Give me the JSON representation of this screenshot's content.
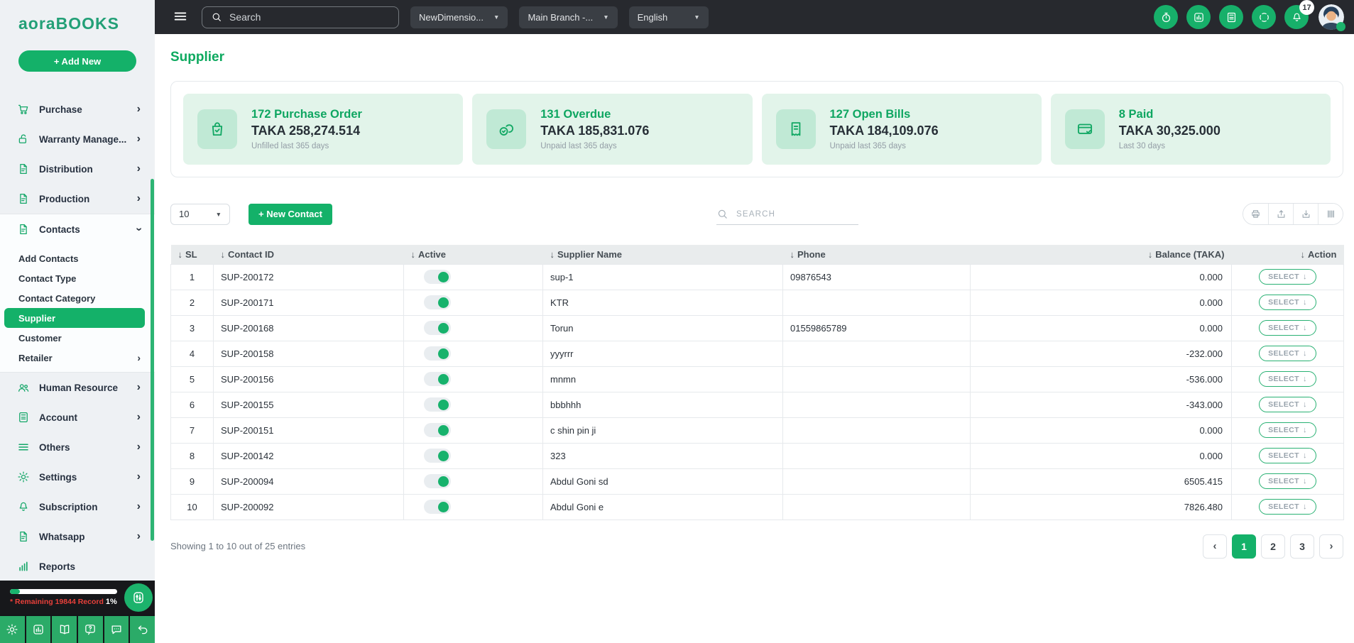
{
  "brand": {
    "logo_text": "aoraBOOKS",
    "add_new_label": "+ Add New"
  },
  "topbar": {
    "search_placeholder": "Search",
    "dropdowns": [
      {
        "label": "NewDimensio..."
      },
      {
        "label": "Main Branch -..."
      },
      {
        "label": "English"
      }
    ],
    "icon_names": [
      "timer-icon",
      "chart-box-icon",
      "calculator-icon",
      "scan-icon",
      "bell-icon"
    ],
    "notification_count": "17"
  },
  "sidebar": {
    "items": [
      {
        "label": "Purchase",
        "icon": "cart-icon",
        "chevron": "›"
      },
      {
        "label": "Warranty Manage...",
        "icon": "lock-open-icon",
        "chevron": "›"
      },
      {
        "label": "Distribution",
        "icon": "document-icon",
        "chevron": "›"
      },
      {
        "label": "Production",
        "icon": "document-icon",
        "chevron": "›"
      }
    ],
    "contacts": {
      "label": "Contacts",
      "icon": "document-icon",
      "chevron": "›",
      "expanded": true
    },
    "contacts_submenu": [
      {
        "label": "Add Contacts",
        "chevron": ""
      },
      {
        "label": "Contact Type",
        "chevron": ""
      },
      {
        "label": "Contact Category",
        "chevron": ""
      },
      {
        "label": "Supplier",
        "chevron": "",
        "active": true
      },
      {
        "label": "Customer",
        "chevron": ""
      },
      {
        "label": "Retailer",
        "chevron": "›"
      }
    ],
    "items_lower": [
      {
        "label": "Human Resource",
        "icon": "users-icon",
        "chevron": "›"
      },
      {
        "label": "Account",
        "icon": "calculator-icon",
        "chevron": "›"
      },
      {
        "label": "Others",
        "icon": "menu-lines-icon",
        "chevron": "›"
      },
      {
        "label": "Settings",
        "icon": "gear-icon",
        "chevron": "›"
      },
      {
        "label": "Subscription",
        "icon": "bell-icon",
        "chevron": "›"
      },
      {
        "label": "Whatsapp",
        "icon": "document-icon",
        "chevron": "›"
      },
      {
        "label": "Reports",
        "icon": "bar-chart-icon",
        "chevron": ""
      }
    ],
    "footer": {
      "remaining_label": "* Remaining 19844 Record",
      "remaining_percent": "1%",
      "progress_value": 1,
      "quick_icons": [
        "gear-icon",
        "chart-box-icon",
        "book-icon",
        "help-icon",
        "chat-icon",
        "undo-icon"
      ]
    }
  },
  "page": {
    "title": "Supplier"
  },
  "summary_cards": [
    {
      "title": "172 Purchase Order",
      "amount": "TAKA 258,274.514",
      "subtitle": "Unfilled last 365 days",
      "icon": "bag-check-icon"
    },
    {
      "title": "131 Overdue",
      "amount": "TAKA 185,831.076",
      "subtitle": "Unpaid last 365 days",
      "icon": "coins-icon"
    },
    {
      "title": "127 Open Bills",
      "amount": "TAKA 184,109.076",
      "subtitle": "Unpaid last 365 days",
      "icon": "receipt-icon"
    },
    {
      "title": "8 Paid",
      "amount": "TAKA 30,325.000",
      "subtitle": "Last 30 days",
      "icon": "card-check-icon"
    }
  ],
  "toolbar": {
    "page_size": "10",
    "new_contact_label": "+ New Contact",
    "search_placeholder": "SEARCH",
    "action_icons": [
      "print-icon",
      "export-icon",
      "download-icon",
      "columns-icon"
    ]
  },
  "table": {
    "sort_arrow": "↓",
    "select_label": "SELECT",
    "headers": [
      "SL",
      "Contact ID",
      "Active",
      "Supplier Name",
      "Phone",
      "Balance (TAKA)",
      "Action"
    ],
    "rows": [
      {
        "sl": "1",
        "contact_id": "SUP-200172",
        "active": true,
        "name": "sup-1",
        "phone": "09876543",
        "balance": "0.000"
      },
      {
        "sl": "2",
        "contact_id": "SUP-200171",
        "active": true,
        "name": "KTR",
        "phone": "",
        "balance": "0.000"
      },
      {
        "sl": "3",
        "contact_id": "SUP-200168",
        "active": true,
        "name": "Torun",
        "phone": "01559865789",
        "balance": "0.000"
      },
      {
        "sl": "4",
        "contact_id": "SUP-200158",
        "active": true,
        "name": "yyyrrr",
        "phone": "",
        "balance": "-232.000"
      },
      {
        "sl": "5",
        "contact_id": "SUP-200156",
        "active": true,
        "name": "mnmn",
        "phone": "",
        "balance": "-536.000"
      },
      {
        "sl": "6",
        "contact_id": "SUP-200155",
        "active": true,
        "name": "bbbhhh",
        "phone": "",
        "balance": "-343.000"
      },
      {
        "sl": "7",
        "contact_id": "SUP-200151",
        "active": true,
        "name": "c shin pin ji",
        "phone": "",
        "balance": "0.000"
      },
      {
        "sl": "8",
        "contact_id": "SUP-200142",
        "active": true,
        "name": "323",
        "phone": "",
        "balance": "0.000"
      },
      {
        "sl": "9",
        "contact_id": "SUP-200094",
        "active": true,
        "name": "Abdul Goni sd",
        "phone": "",
        "balance": "6505.415"
      },
      {
        "sl": "10",
        "contact_id": "SUP-200092",
        "active": true,
        "name": "Abdul Goni e",
        "phone": "",
        "balance": "7826.480"
      }
    ]
  },
  "pagination": {
    "summary": "Showing 1 to 10 out of 25 entries",
    "prev": "‹",
    "next": "›",
    "pages": [
      {
        "label": "1",
        "active": true
      },
      {
        "label": "2"
      },
      {
        "label": "3"
      }
    ]
  },
  "ui": {
    "caret_down": "▼",
    "hamburger_icon": "menu-lines-icon",
    "search_icon": "search-icon",
    "sliders_icon": "sliders-icon"
  },
  "colors": {
    "accent_green": "#14b169",
    "topbar_bg": "#27292e",
    "danger_red": "#e8403a",
    "card_bg": "#e2f4ea"
  }
}
